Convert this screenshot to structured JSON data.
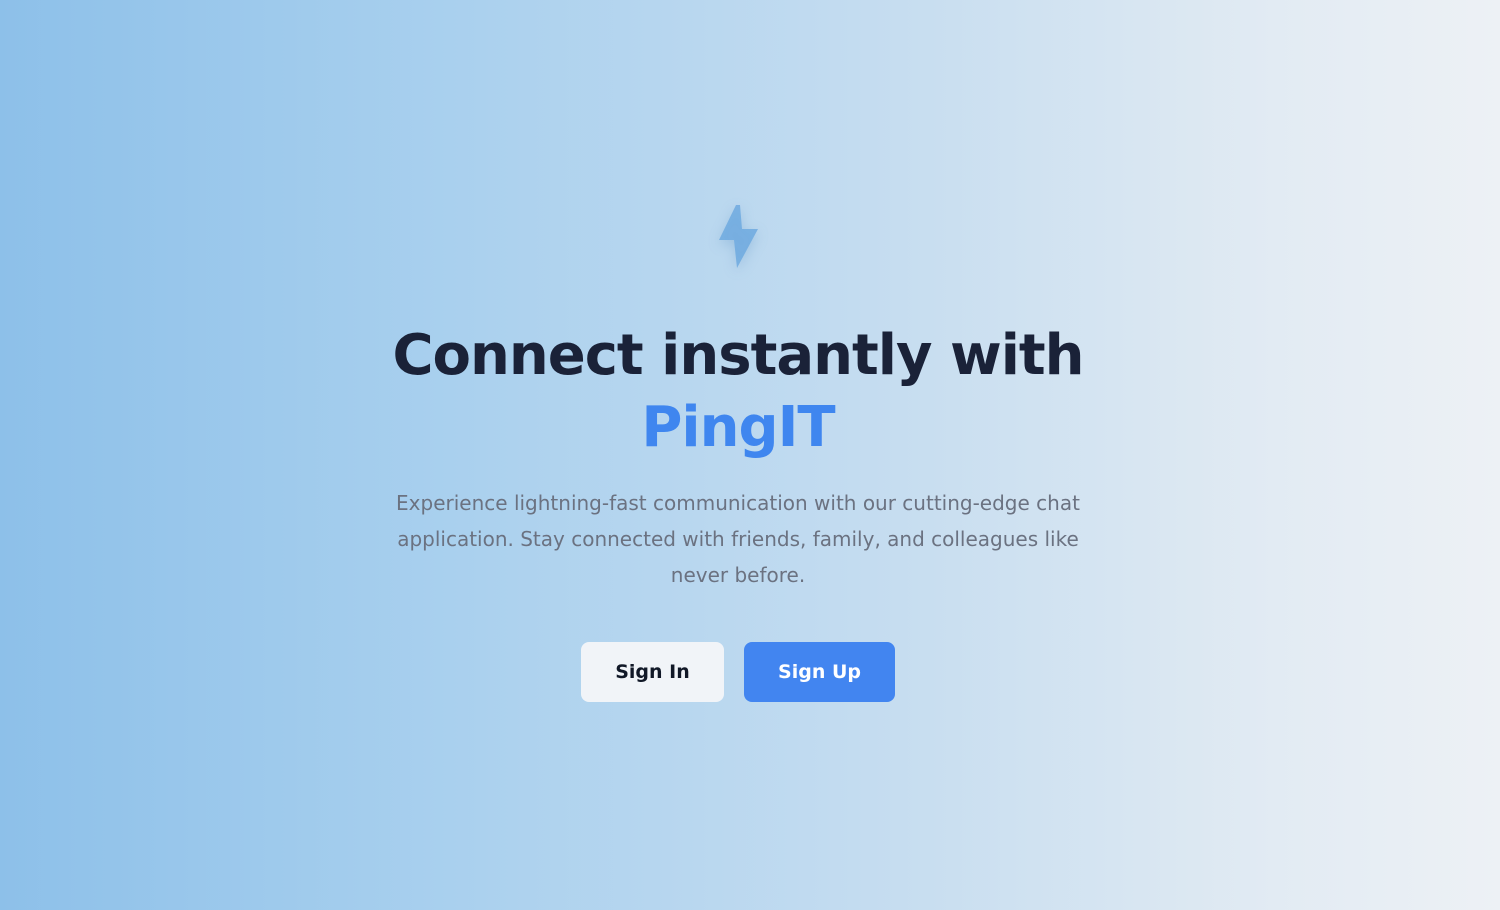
{
  "hero": {
    "logo_icon": "lightning-bolt-icon",
    "headline_line1": "Connect instantly with",
    "headline_brand": "PingIT",
    "tagline": "Experience lightning-fast communication with our cutting-edge chat application. Stay connected with friends, family, and colleagues like never before.",
    "signin_label": "Sign In",
    "signup_label": "Sign Up"
  },
  "colors": {
    "accent": "#4285f0",
    "headline": "#1a2238",
    "tagline": "#6b7281",
    "logo": "#72ace0"
  }
}
